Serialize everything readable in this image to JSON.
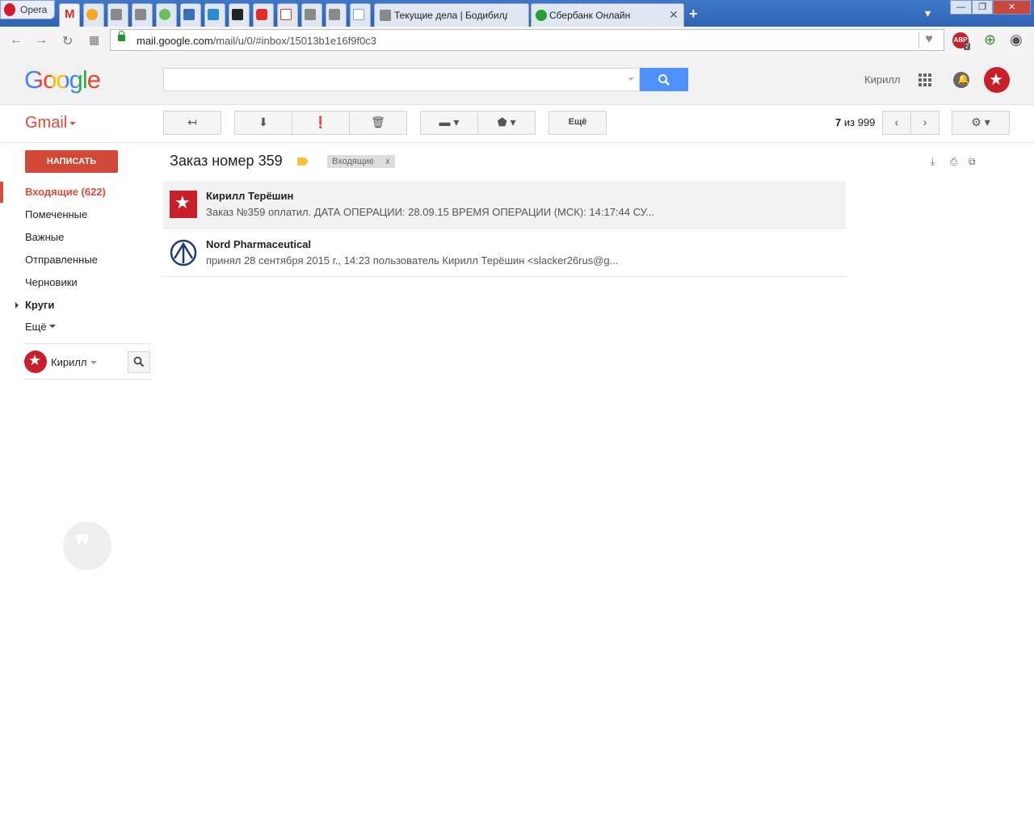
{
  "browser": {
    "app_name": "Opera",
    "tabs": [
      {
        "title": "Текущие дела | Бодибилд",
        "icon": "forum-icon"
      },
      {
        "title": "Сбербанк Онлайн",
        "icon": "sberbank-icon"
      }
    ],
    "url_domain": "mail.google.com",
    "url_path": "/mail/u/0/#inbox/15013b1e16f9f0c3",
    "abp_label": "ABP",
    "abp_count": "2"
  },
  "header": {
    "logo": "Google",
    "user_name": "Кирилл",
    "search_placeholder": ""
  },
  "toolbar": {
    "gmail_label": "Gmail",
    "more_label": "Ещё",
    "pager_current": "7",
    "pager_sep": "из",
    "pager_total": "999"
  },
  "sidebar": {
    "compose": "НАПИСАТЬ",
    "items": [
      {
        "label": "Входящие (622)"
      },
      {
        "label": "Помеченные"
      },
      {
        "label": "Важные"
      },
      {
        "label": "Отправленные"
      },
      {
        "label": "Черновики"
      },
      {
        "label": "Круги"
      },
      {
        "label": "Ещё"
      }
    ],
    "hangouts_user": "Кирилл"
  },
  "thread": {
    "subject": "Заказ номер 359",
    "label": "Входящие",
    "label_remove": "x",
    "messages": [
      {
        "from": "Кирилл Терёшин",
        "snippet": "Заказ №359 оплатил. ДАТА ОПЕРАЦИИ: 28.09.15 ВРЕМЯ ОПЕРАЦИИ (МСК): 14:17:44 СУ..."
      },
      {
        "from": "Nord Pharmaceutical",
        "snippet": "принял 28 сентября 2015 г., 14:23 пользователь Кирилл Терёшин <slacker26rus@g..."
      }
    ]
  },
  "colors": {
    "gmail_red": "#dd4b39",
    "compose_red": "#d14836",
    "search_blue": "#4d90fe"
  }
}
